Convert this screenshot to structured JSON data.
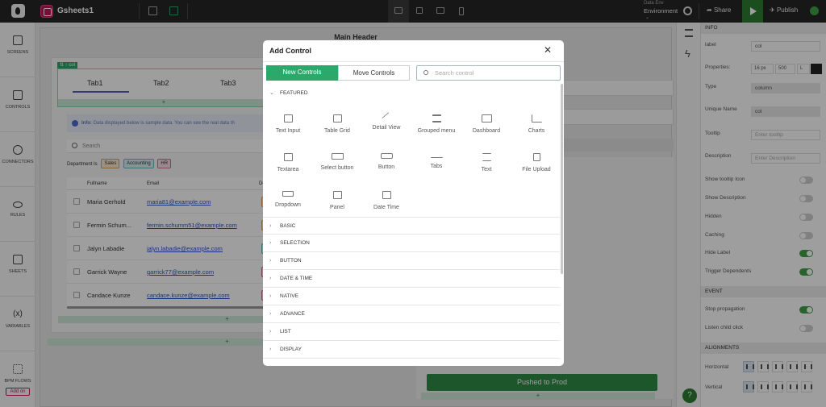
{
  "topbar": {
    "app_name": "Gsheets1",
    "env_label": "Data Env",
    "env_value": "Environment",
    "env_arrow": "⌄",
    "share_label": "Share",
    "publish_label": "Publish"
  },
  "sidebar": {
    "items": [
      {
        "label": "SCREENS",
        "icon": "screens-icon"
      },
      {
        "label": "CONTROLS",
        "icon": "controls-icon"
      },
      {
        "label": "CONNECTORS",
        "icon": "connectors-icon"
      },
      {
        "label": "RULES",
        "icon": "rules-icon"
      },
      {
        "label": "SHEETS",
        "icon": "sheets-icon"
      },
      {
        "label": "VARIABLES",
        "icon": "variables-icon"
      },
      {
        "label": "BPM FLOWS",
        "icon": "bpm-flows-icon"
      }
    ],
    "addon_label": "Add on"
  },
  "canvas": {
    "main_header": "Main Header",
    "col_tag": "⇅ ↑ col",
    "tabs": [
      "Tab1",
      "Tab2",
      "Tab3"
    ],
    "plus": "+",
    "info_prefix": "Info:",
    "info_text": "Data displayed below is sample data. You can see the real data th",
    "search_placeholder": "Search",
    "department_label": "Department Is",
    "department_chips": [
      "Sales",
      "Accounting",
      "HR"
    ],
    "grid_headers": [
      "Fullname",
      "Email",
      "De"
    ],
    "rows": [
      {
        "name": "Maria Gerhold",
        "email": "maria81@example.com"
      },
      {
        "name": "Fermin Schum...",
        "email": "fermin.schumm51@example.com"
      },
      {
        "name": "Jalyn Labadie",
        "email": "jalyn.labadie@example.com"
      },
      {
        "name": "Garrick Wayne",
        "email": "garrick77@example.com"
      },
      {
        "name": "Candace Kunze",
        "email": "candace.kunze@example.com"
      }
    ],
    "pushed_button": "Pushed to Prod"
  },
  "modal": {
    "title": "Add Control",
    "close": "✕",
    "tab_new": "New Controls",
    "tab_move": "Move Controls",
    "search_placeholder": "Search control",
    "featured_label": "FEATURED",
    "controls": [
      "Text Input",
      "Table Grid",
      "Detail View",
      "Grouped menu",
      "Dashboard",
      "Charts",
      "Textarea",
      "Select button",
      "Button",
      "Tabs",
      "Text",
      "File Upload",
      "Dropdown",
      "Panel",
      "Date Time"
    ],
    "sections": [
      "BASIC",
      "SELECTION",
      "BUTTON",
      "DATE & TIME",
      "NATIVE",
      "ADVANCE",
      "LIST",
      "DISPLAY"
    ]
  },
  "properties": {
    "info_section": "INFO",
    "label_label": "label",
    "label_value": "col",
    "properties_label": "Properties:",
    "font_size": "16 px",
    "font_weight": "500",
    "align": "L",
    "type_label": "Type",
    "type_value": "column",
    "unique_label": "Unique Name",
    "unique_value": "col",
    "tooltip_label": "Tooltip",
    "tooltip_placeholder": "Enter tooltip",
    "description_label": "Description",
    "description_placeholder": "Enter Description",
    "toggles": [
      {
        "label": "Show tooltip Icon",
        "on": false
      },
      {
        "label": "Show Description",
        "on": false
      },
      {
        "label": "Hidden",
        "on": false
      },
      {
        "label": "Caching",
        "on": false
      },
      {
        "label": "Hide Label",
        "on": true
      },
      {
        "label": "Trigger Dependents",
        "on": true
      }
    ],
    "event_section": "EVENT",
    "event_toggles": [
      {
        "label": "Stop propagation",
        "on": true
      },
      {
        "label": "Listen child click",
        "on": false
      }
    ],
    "alignments_section": "ALIGNMENTS",
    "horizontal_label": "Horizontal",
    "vertical_label": "Vertical",
    "help": "?"
  },
  "colors": {
    "accent": "#2ba86a",
    "topbar": "#262626",
    "pushed": "#2e8b45",
    "link": "#2a55c9"
  }
}
